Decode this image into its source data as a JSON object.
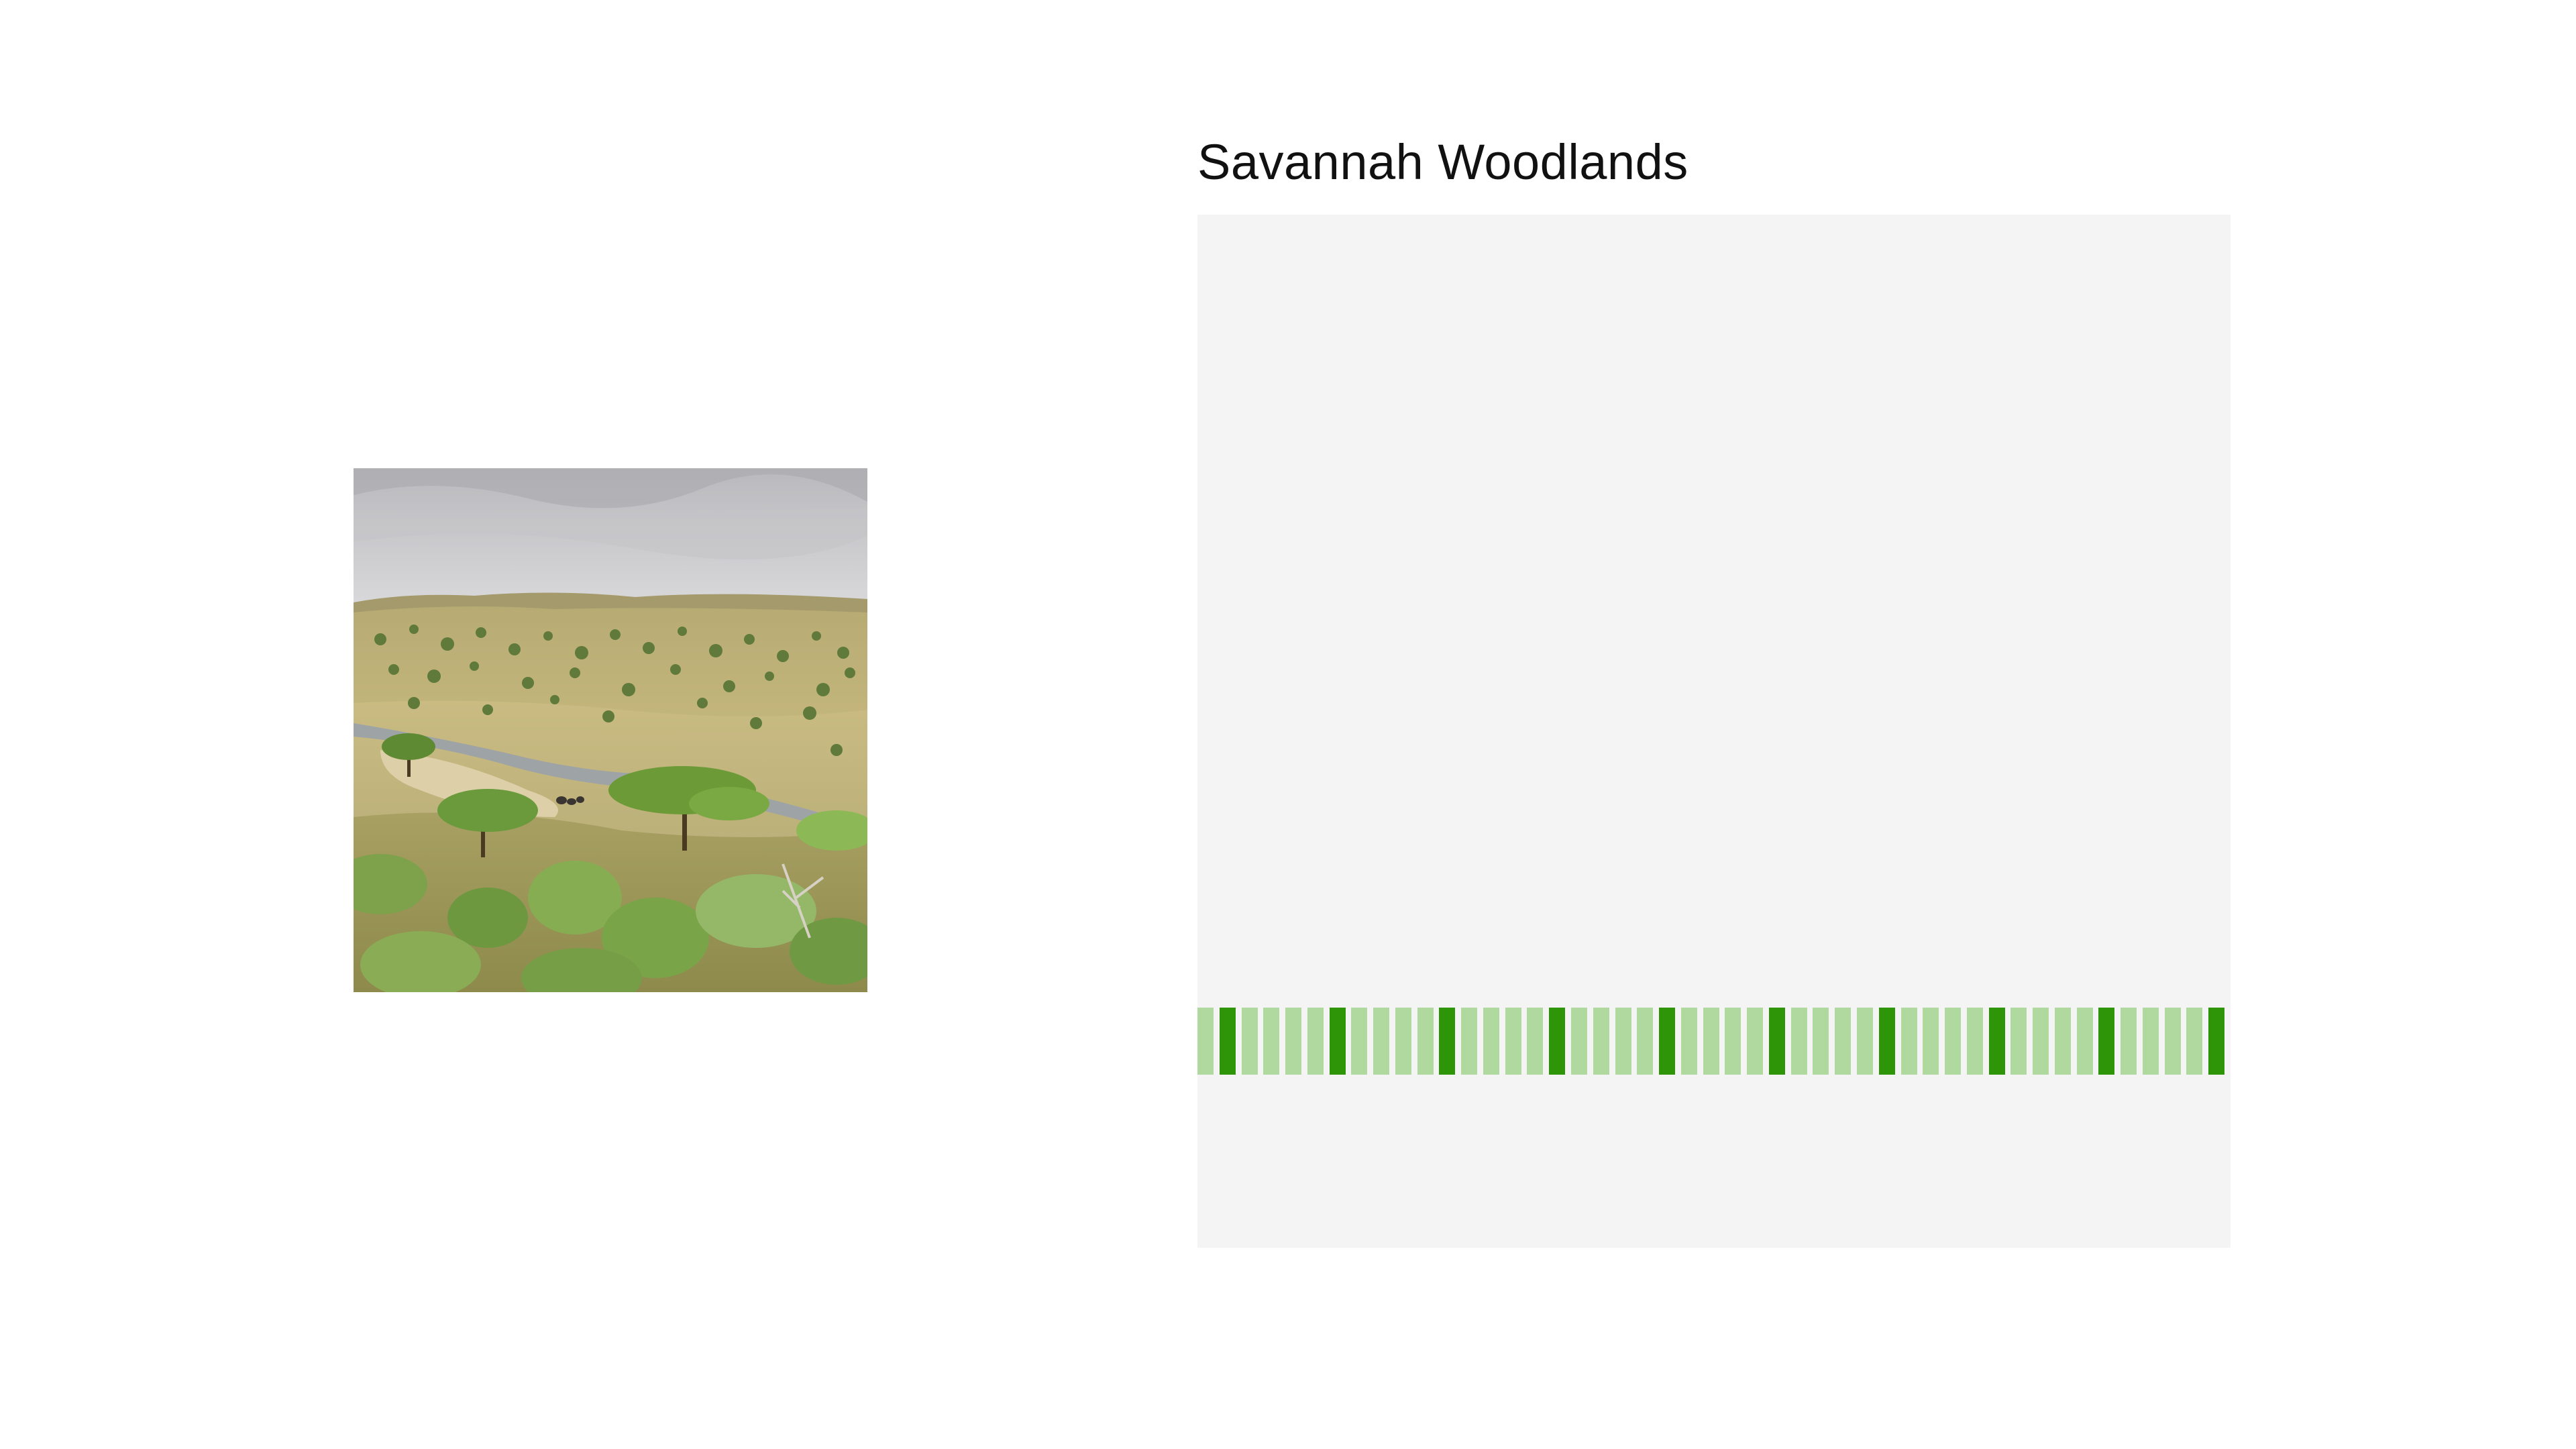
{
  "title": "Savannah Woodlands",
  "photo": {
    "icon": "savannah-landscape-photo"
  },
  "stripes": {
    "count": 47,
    "pattern": [
      "light",
      "dark",
      "light",
      "light",
      "light"
    ],
    "colors": {
      "light": "#b0d9a0",
      "dark": "#2e9408"
    }
  },
  "colors": {
    "background": "#ffffff",
    "panel": "#f4f4f4",
    "title": "#111111"
  }
}
